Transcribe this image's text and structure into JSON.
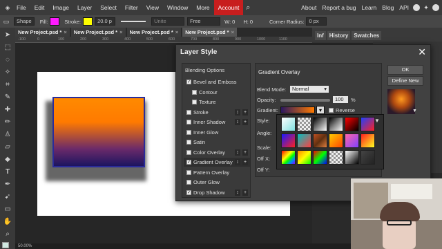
{
  "menu": {
    "items": [
      "File",
      "Edit",
      "Image",
      "Layer",
      "Select",
      "Filter",
      "View",
      "Window",
      "More"
    ],
    "account": "Account",
    "right_items": [
      "About",
      "Report a bug",
      "Learn",
      "Blog",
      "API"
    ]
  },
  "options_bar": {
    "shape": "Shape",
    "fill_label": "Fill:",
    "stroke_label": "Stroke:",
    "stroke_width": "20.0 p",
    "unite": "Unite",
    "free": "Free",
    "w_label": "W:",
    "w_value": "0",
    "h_label": "H:",
    "h_value": "0",
    "corner_label": "Corner Radius:",
    "corner_value": "0 px",
    "fill_color": "#ff1aff",
    "stroke_color": "#ffff00"
  },
  "tabs": [
    "New Project.psd *",
    "New Project.psd *",
    "New Project.psd *",
    "New Project.psd *"
  ],
  "ruler_ticks": [
    "-100",
    "0",
    "100",
    "200",
    "300",
    "400",
    "500",
    "600",
    "700",
    "800",
    "900",
    "1000",
    "1100"
  ],
  "right_panel": {
    "tabs": [
      "Inf",
      "History",
      "Swatches"
    ]
  },
  "status": {
    "zoom": "50.00%"
  },
  "dialog": {
    "title": "Layer Style",
    "blending_options": "Blending Options",
    "styles": [
      {
        "label": "Bevel and Emboss",
        "checked": true,
        "sub": false,
        "pm": false
      },
      {
        "label": "Contour",
        "checked": false,
        "sub": true,
        "pm": false
      },
      {
        "label": "Texture",
        "checked": false,
        "sub": true,
        "pm": false
      },
      {
        "label": "Stroke",
        "checked": false,
        "sub": false,
        "pm": true
      },
      {
        "label": "Inner Shadow",
        "checked": false,
        "sub": false,
        "pm": true
      },
      {
        "label": "Inner Glow",
        "checked": false,
        "sub": false,
        "pm": false
      },
      {
        "label": "Satin",
        "checked": false,
        "sub": false,
        "pm": false
      },
      {
        "label": "Color Overlay",
        "checked": false,
        "sub": false,
        "pm": true
      },
      {
        "label": "Gradient Overlay",
        "checked": true,
        "sub": false,
        "pm": true
      },
      {
        "label": "Pattern Overlay",
        "checked": false,
        "sub": false,
        "pm": false
      },
      {
        "label": "Outer Glow",
        "checked": false,
        "sub": false,
        "pm": false
      },
      {
        "label": "Drop Shadow",
        "checked": true,
        "sub": false,
        "pm": true
      }
    ],
    "section_title": "Gradient Overlay",
    "blend_mode_label": "Blend Mode:",
    "blend_mode_value": "Normal",
    "opacity_label": "Opacity:",
    "opacity_value": "100",
    "opacity_unit": "%",
    "gradient_label": "Gradient:",
    "reverse_label": "Reverse",
    "style_label": "Style:",
    "angle_label": "Angle:",
    "scale_label": "Scale:",
    "offx_label": "Off X:",
    "offy_label": "Off Y:",
    "ok_label": "OK",
    "define_new_label": "Define New"
  }
}
